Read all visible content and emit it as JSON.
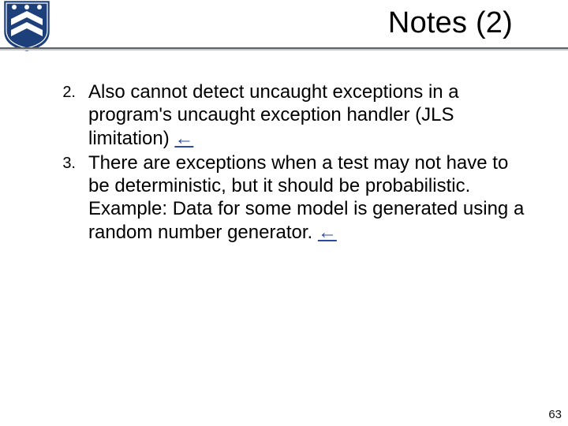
{
  "header": {
    "title": "Notes (2)"
  },
  "items": [
    {
      "number": "2.",
      "text": "Also cannot detect uncaught exceptions in a program's uncaught exception handler (JLS limitation) ",
      "back_arrow": "←"
    },
    {
      "number": "3.",
      "text": "There are exceptions when a test may not have to be deterministic, but it should be probabilistic. Example: Data for some model is generated using a random number generator. ",
      "back_arrow": "←"
    }
  ],
  "page_number": "63"
}
